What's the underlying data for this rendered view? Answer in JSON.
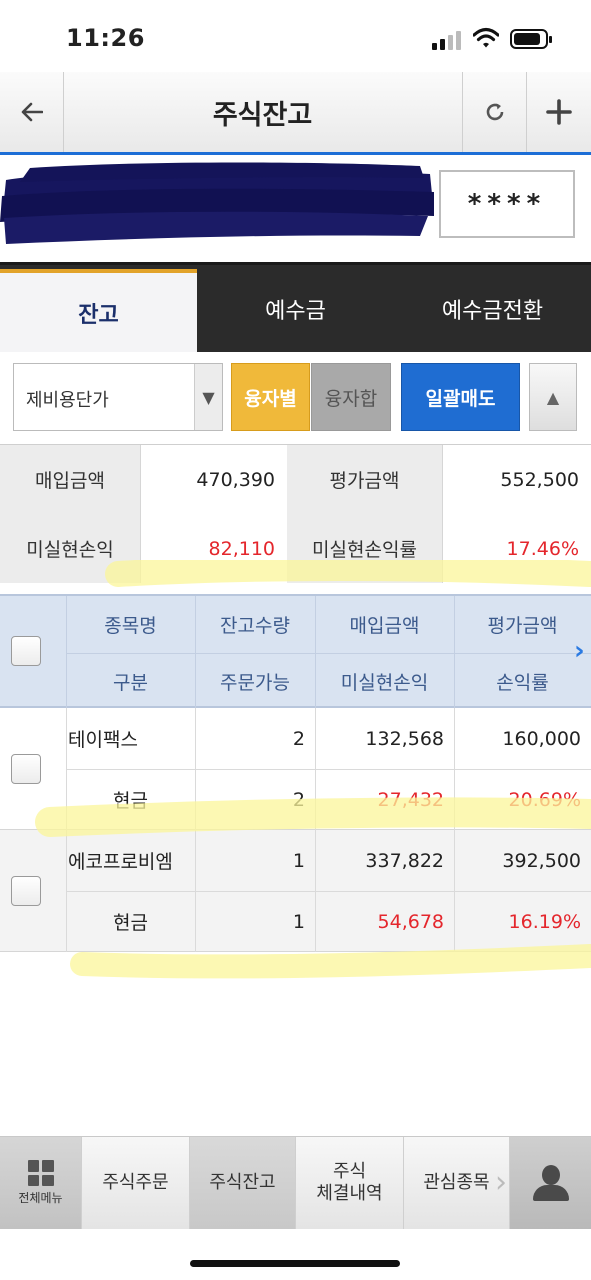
{
  "status_bar": {
    "time": "11:26"
  },
  "header": {
    "title": "주식잔고",
    "back_icon": "←",
    "refresh_icon": "↻",
    "add_icon": "+"
  },
  "account": {
    "password_mask": "****"
  },
  "tabs": [
    {
      "label": "잔고",
      "active": true
    },
    {
      "label": "예수금",
      "active": false
    },
    {
      "label": "예수금전환",
      "active": false
    }
  ],
  "controls": {
    "select_value": "제비용단가",
    "btn_by_loan": "융자별",
    "btn_loan_sum": "융자합",
    "btn_bulk_sell": "일괄매도",
    "btn_collapse": "▲"
  },
  "summary": {
    "purchase_label": "매입금액",
    "purchase_value": "470,390",
    "eval_label": "평가금액",
    "eval_value": "552,500",
    "unrealized_label": "미실현손익",
    "unrealized_value": "82,110",
    "unrealized_rate_label": "미실현손익률",
    "unrealized_rate_value": "17.46%"
  },
  "table": {
    "headers_row1": [
      "종목명",
      "잔고수량",
      "매입금액",
      "평가금액"
    ],
    "headers_row2": [
      "구분",
      "주문가능",
      "미실현손익",
      "손익률"
    ],
    "rows": [
      {
        "name": "테이팩스",
        "qty": "2",
        "purchase": "132,568",
        "eval": "160,000",
        "kind": "현금",
        "orderable": "2",
        "unrealized": "27,432",
        "rate": "20.69%"
      },
      {
        "name": "에코프로비엠",
        "qty": "1",
        "purchase": "337,822",
        "eval": "392,500",
        "kind": "현금",
        "orderable": "1",
        "unrealized": "54,678",
        "rate": "16.19%"
      }
    ]
  },
  "bottom_nav": {
    "menu_label": "전체메뉴",
    "items": [
      "주식주문",
      "주식잔고",
      "주식\n체결내역",
      "관심종목"
    ]
  },
  "colors": {
    "accent_blue": "#1f6dd2",
    "profit_red": "#e4262c",
    "button_yellow": "#f0b93a"
  }
}
